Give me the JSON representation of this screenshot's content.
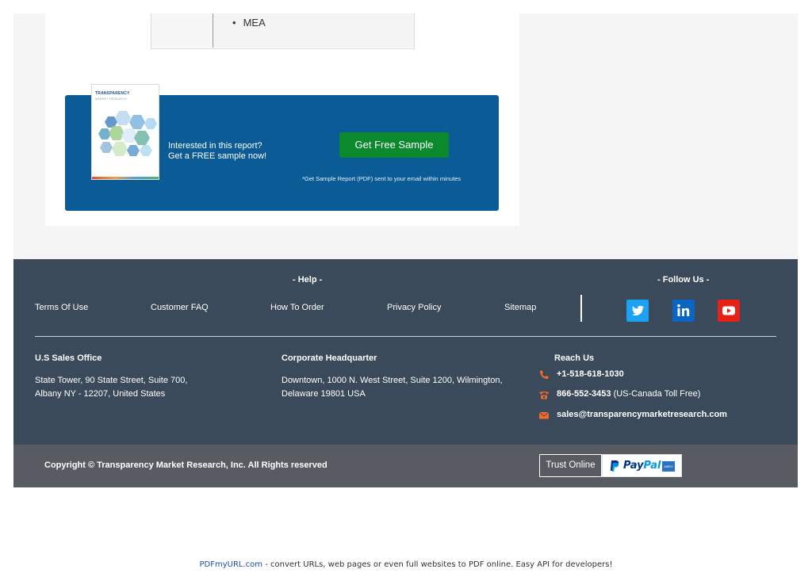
{
  "region_table": {
    "bullet_item": "MEA"
  },
  "sample_banner": {
    "line1": "Interested in this report?",
    "line2": "Get a FREE sample now!",
    "button_label": "Get Free Sample",
    "note": "*Get Sample Report (PDF) sent to your email within minutes",
    "cover_logo": "TRANSPARENCY",
    "cover_logo_sub": "MARKET RESEARCH"
  },
  "footer": {
    "help_heading": "- Help -",
    "follow_heading": "- Follow Us -",
    "links": [
      {
        "label": "Terms Of Use"
      },
      {
        "label": "Customer FAQ"
      },
      {
        "label": "How To Order"
      },
      {
        "label": "Privacy Policy"
      },
      {
        "label": "Sitemap"
      }
    ],
    "social": [
      {
        "icon": "twitter-icon",
        "color": "#1da1f2"
      },
      {
        "icon": "linkedin-icon",
        "color": "#0a66c2"
      },
      {
        "icon": "youtube-icon",
        "color": "#e62117"
      }
    ],
    "us_office": {
      "title": "U.S Sales Office",
      "line1": "State Tower, 90 State Street, Suite 700,",
      "line2": "Albany NY - 12207, United States"
    },
    "headquarter": {
      "title": "Corporate Headquarter",
      "line1": "Downtown, 1000 N. West Street, Suite 1200, Wilmington,",
      "line2": "Delaware 19801 USA"
    },
    "reach_us": {
      "title": "Reach Us",
      "phone": "+1-518-618-1030",
      "toll_free": "866-552-3453",
      "toll_free_note": " (US-Canada Toll Free)",
      "email": "sales@transparencymarketresearch.com",
      "icon_color": "#f26b2a"
    }
  },
  "copyright_bar": {
    "text": "Copyright © Transparency Market Research, Inc. All Rights reserved",
    "trust_label": "Trust Online",
    "paypal_pay": "Pay",
    "paypal_pal": "Pal",
    "amex_label": "AMEX"
  },
  "pdf_note": {
    "link_text": "PDFmyURL.com",
    "rest": " - convert URLs, web pages or even full websites to PDF online. Easy API for developers!"
  },
  "colors": {
    "banner_blue": "#0b5c96",
    "button_green": "#0a8a2c",
    "footer_bg": "#3b4a5a",
    "copyright_bg": "#585c62"
  }
}
